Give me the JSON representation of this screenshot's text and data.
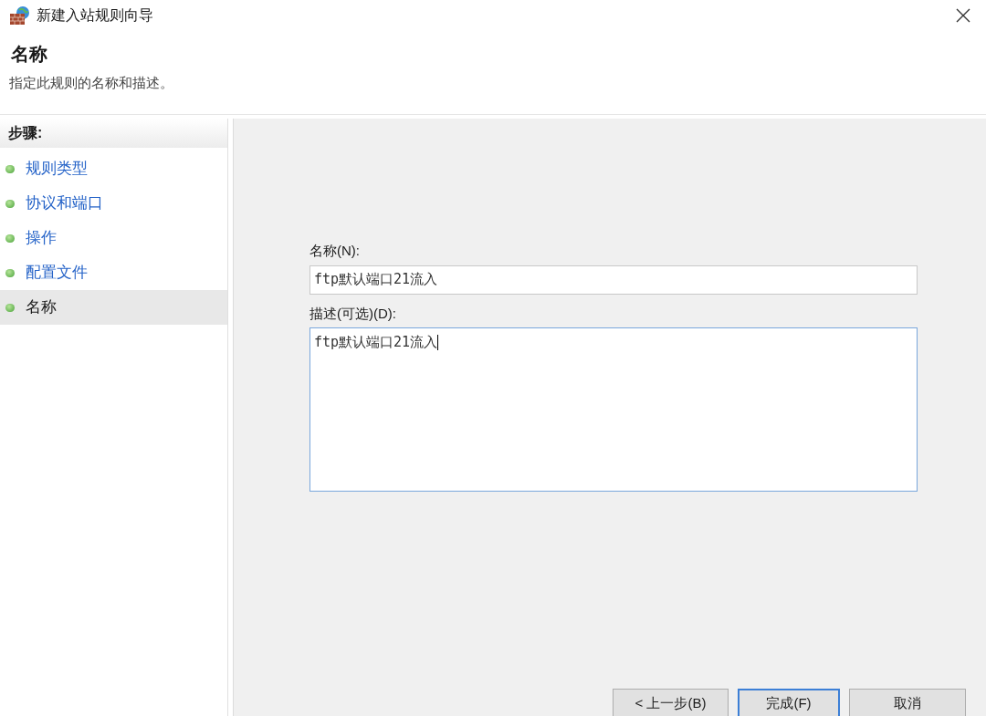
{
  "window": {
    "title": "新建入站规则向导"
  },
  "header": {
    "title": "名称",
    "subtitle": "指定此规则的名称和描述。"
  },
  "steps": {
    "heading": "步骤:",
    "items": [
      {
        "label": "规则类型",
        "selected": false
      },
      {
        "label": "协议和端口",
        "selected": false
      },
      {
        "label": "操作",
        "selected": false
      },
      {
        "label": "配置文件",
        "selected": false
      },
      {
        "label": "名称",
        "selected": true
      }
    ]
  },
  "form": {
    "name_label": "名称(N):",
    "name_value": "ftp默认端口21流入",
    "description_label": "描述(可选)(D):",
    "description_value": "ftp默认端口21流入",
    "description_focused": true
  },
  "buttons": [
    {
      "label": "< 上一步(B)",
      "default": false
    },
    {
      "label": "完成(F)",
      "default": true
    },
    {
      "label": "取消",
      "default": false
    }
  ]
}
